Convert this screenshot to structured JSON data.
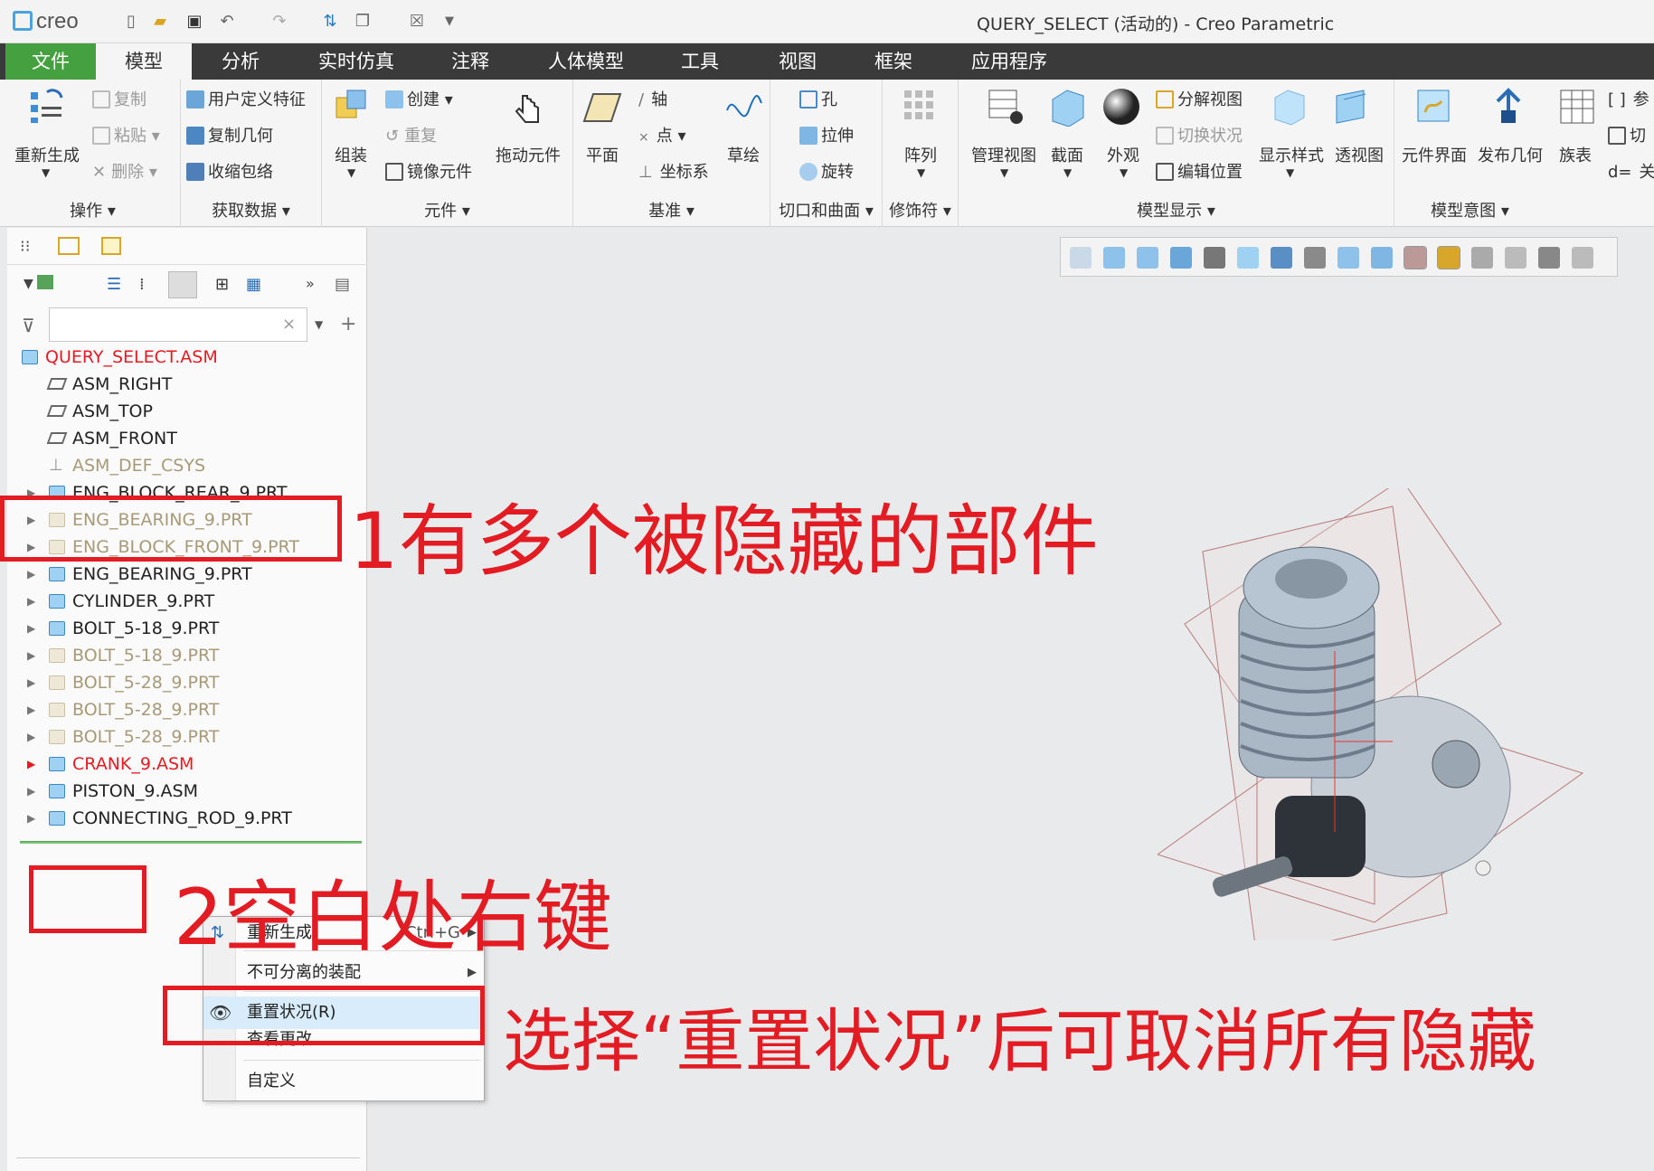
{
  "app": {
    "logo": "creo",
    "title": "QUERY_SELECT (活动的) - Creo Parametric"
  },
  "tabs": [
    "文件",
    "模型",
    "分析",
    "实时仿真",
    "注释",
    "人体模型",
    "工具",
    "视图",
    "框架",
    "应用程序"
  ],
  "ribbon": {
    "regenerate": "重新生成",
    "copy": "复制",
    "paste": "粘贴",
    "delete": "删除",
    "user_feature": "用户定义特征",
    "copy_geom": "复制几何",
    "shrinkwrap": "收缩包络",
    "assemble": "组装",
    "create": "创建",
    "repeat": "重复",
    "mirror_comp": "镜像元件",
    "drag_comp": "拖动元件",
    "plane": "平面",
    "axis": "轴",
    "point": "点",
    "csys": "坐标系",
    "sketch": "草绘",
    "hole": "孔",
    "extrude": "拉伸",
    "revolve": "旋转",
    "pattern": "阵列",
    "manage_views": "管理视图",
    "section": "截面",
    "appearance": "外观",
    "explode_view": "分解视图",
    "toggle_status": "切换状况",
    "edit_position": "编辑位置",
    "display_style": "显示样式",
    "perspective": "透视图",
    "comp_interface": "元件界面",
    "publish_geom": "发布几何",
    "family_table": "族表",
    "params": "参",
    "switch": "切",
    "relations": "关",
    "groups": {
      "operations": "操作",
      "get_data": "获取数据",
      "components": "元件",
      "datum": "基准",
      "cuts_surfaces": "切口和曲面",
      "modifiers": "修饰符",
      "model_display": "模型显示",
      "model_intent": "模型意图"
    }
  },
  "tree": {
    "search_placeholder": "",
    "items": [
      {
        "label": "QUERY_SELECT.ASM",
        "state": "root"
      },
      {
        "label": "ASM_RIGHT",
        "state": "datum"
      },
      {
        "label": "ASM_TOP",
        "state": "datum"
      },
      {
        "label": "ASM_FRONT",
        "state": "datum"
      },
      {
        "label": "ASM_DEF_CSYS",
        "state": "csys"
      },
      {
        "label": "ENG_BLOCK_REAR_9.PRT",
        "state": "normal"
      },
      {
        "label": "ENG_BEARING_9.PRT",
        "state": "hidden"
      },
      {
        "label": "ENG_BLOCK_FRONT_9.PRT",
        "state": "hidden"
      },
      {
        "label": "ENG_BEARING_9.PRT",
        "state": "normal"
      },
      {
        "label": "CYLINDER_9.PRT",
        "state": "normal"
      },
      {
        "label": "BOLT_5-18_9.PRT",
        "state": "normal"
      },
      {
        "label": "BOLT_5-18_9.PRT",
        "state": "hidden"
      },
      {
        "label": "BOLT_5-28_9.PRT",
        "state": "hidden"
      },
      {
        "label": "BOLT_5-28_9.PRT",
        "state": "hidden"
      },
      {
        "label": "BOLT_5-28_9.PRT",
        "state": "hidden"
      },
      {
        "label": "CRANK_9.ASM",
        "state": "warn"
      },
      {
        "label": "PISTON_9.ASM",
        "state": "normal"
      },
      {
        "label": "CONNECTING_ROD_9.PRT",
        "state": "normal"
      }
    ]
  },
  "context_menu": {
    "regenerate": "重新生成",
    "regenerate_shortcut": "Ctrl+G",
    "inseparable": "不可分离的装配",
    "reset_status": "重置状况(R)",
    "view_changes": "查看更改",
    "customize": "自定义"
  },
  "annotations": {
    "a1": "1有多个被隐藏的部件",
    "a2": "2空白处右键",
    "a3": "选择“重置状况”后可取消所有隐藏"
  },
  "colors": {
    "accent_red": "#e31c23",
    "file_tab": "#45a040",
    "tab_bar": "#3a3a3a",
    "hidden_text": "#a89a78",
    "warn_text": "#e31c23"
  }
}
